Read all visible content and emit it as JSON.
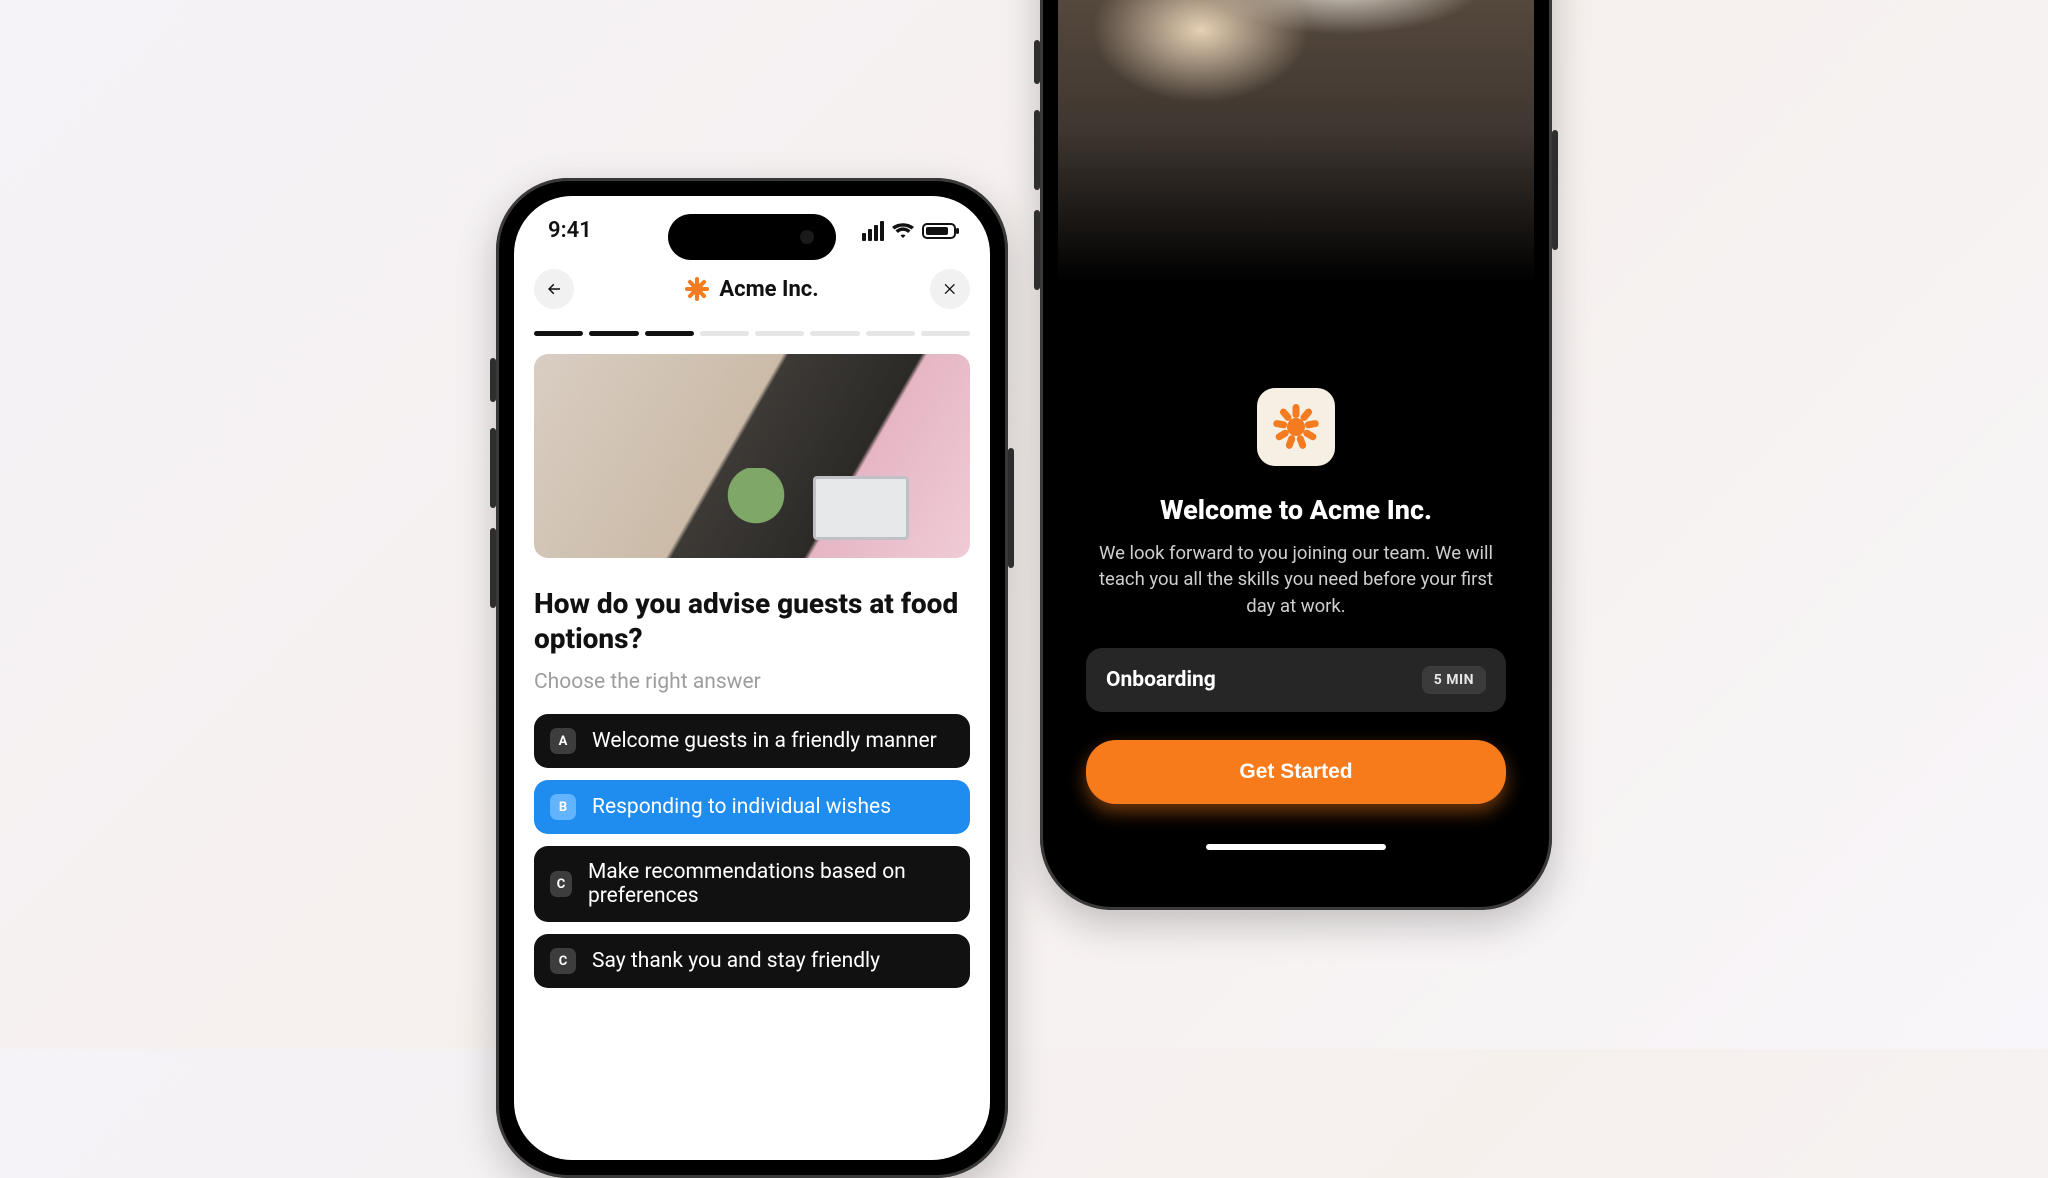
{
  "statusbar": {
    "time": "9:41"
  },
  "left": {
    "header_title": "Acme Inc.",
    "progress_total": 8,
    "progress_filled": 3,
    "question": "How do you advise guests at food options?",
    "hint": "Choose the right answer",
    "answers": [
      {
        "letter": "A",
        "text": "Welcome guests in a friendly manner",
        "selected": false
      },
      {
        "letter": "B",
        "text": "Responding to individual wishes",
        "selected": true
      },
      {
        "letter": "C",
        "text": "Make recommendations based on preferences",
        "selected": false
      },
      {
        "letter": "C",
        "text": "Say thank you and stay friendly",
        "selected": false
      }
    ]
  },
  "right": {
    "title": "Welcome to Acme Inc.",
    "subtitle": "We look forward to you joining our team. We will teach you all the skills you need before your first day at work.",
    "card_label": "Onboarding",
    "card_badge": "5 MIN",
    "cta": "Get Started"
  },
  "colors": {
    "accent": "#f77a1b",
    "selected": "#1f8cf0"
  }
}
